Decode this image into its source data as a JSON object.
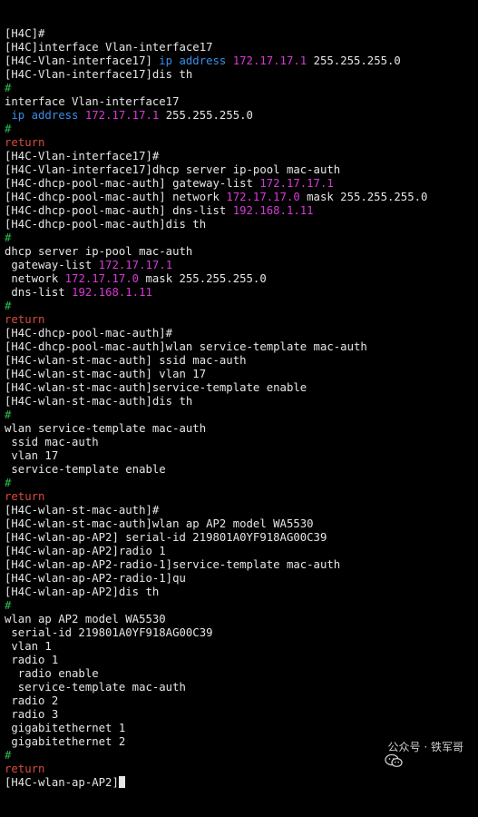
{
  "colors": {
    "text": "#e6e6e6",
    "keyword": "#3a8ee6",
    "ip": "#d63ad6",
    "comment": "#2fb84e",
    "return": "#d94b3c",
    "background": "#000000"
  },
  "lines": [
    [
      {
        "t": "[H4C]#",
        "c": "text"
      }
    ],
    [
      {
        "t": "[H4C]interface Vlan-interface17",
        "c": "text"
      }
    ],
    [
      {
        "t": "[H4C-Vlan-interface17] ",
        "c": "text"
      },
      {
        "t": "ip address",
        "c": "keyword"
      },
      {
        "t": " ",
        "c": "text"
      },
      {
        "t": "172.17.17.1",
        "c": "ip"
      },
      {
        "t": " 255.255.255.0",
        "c": "text"
      }
    ],
    [
      {
        "t": "[H4C-Vlan-interface17]dis th",
        "c": "text"
      }
    ],
    [
      {
        "t": "#",
        "c": "comment"
      }
    ],
    [
      {
        "t": "interface Vlan-interface17",
        "c": "text"
      }
    ],
    [
      {
        "t": " ",
        "c": "text"
      },
      {
        "t": "ip address",
        "c": "keyword"
      },
      {
        "t": " ",
        "c": "text"
      },
      {
        "t": "172.17.17.1",
        "c": "ip"
      },
      {
        "t": " 255.255.255.0",
        "c": "text"
      }
    ],
    [
      {
        "t": "#",
        "c": "comment"
      }
    ],
    [
      {
        "t": "return",
        "c": "return"
      }
    ],
    [
      {
        "t": "[H4C-Vlan-interface17]#",
        "c": "text"
      }
    ],
    [
      {
        "t": "[H4C-Vlan-interface17]dhcp server ip-pool mac-auth",
        "c": "text"
      }
    ],
    [
      {
        "t": "[H4C-dhcp-pool-mac-auth] gateway-list ",
        "c": "text"
      },
      {
        "t": "172.17.17.1",
        "c": "ip"
      }
    ],
    [
      {
        "t": "[H4C-dhcp-pool-mac-auth] network ",
        "c": "text"
      },
      {
        "t": "172.17.17.0",
        "c": "ip"
      },
      {
        "t": " mask 255.255.255.0",
        "c": "text"
      }
    ],
    [
      {
        "t": "[H4C-dhcp-pool-mac-auth] dns-list ",
        "c": "text"
      },
      {
        "t": "192.168.1.11",
        "c": "ip"
      }
    ],
    [
      {
        "t": "[H4C-dhcp-pool-mac-auth]dis th",
        "c": "text"
      }
    ],
    [
      {
        "t": "#",
        "c": "comment"
      }
    ],
    [
      {
        "t": "dhcp server ip-pool mac-auth",
        "c": "text"
      }
    ],
    [
      {
        "t": " gateway-list ",
        "c": "text"
      },
      {
        "t": "172.17.17.1",
        "c": "ip"
      }
    ],
    [
      {
        "t": " network ",
        "c": "text"
      },
      {
        "t": "172.17.17.0",
        "c": "ip"
      },
      {
        "t": " mask 255.255.255.0",
        "c": "text"
      }
    ],
    [
      {
        "t": " dns-list ",
        "c": "text"
      },
      {
        "t": "192.168.1.11",
        "c": "ip"
      }
    ],
    [
      {
        "t": "#",
        "c": "comment"
      }
    ],
    [
      {
        "t": "return",
        "c": "return"
      }
    ],
    [
      {
        "t": "[H4C-dhcp-pool-mac-auth]#",
        "c": "text"
      }
    ],
    [
      {
        "t": "[H4C-dhcp-pool-mac-auth]wlan service-template mac-auth",
        "c": "text"
      }
    ],
    [
      {
        "t": "[H4C-wlan-st-mac-auth] ssid mac-auth",
        "c": "text"
      }
    ],
    [
      {
        "t": "[H4C-wlan-st-mac-auth] vlan 17",
        "c": "text"
      }
    ],
    [
      {
        "t": "[H4C-wlan-st-mac-auth]service-template enable",
        "c": "text"
      }
    ],
    [
      {
        "t": "[H4C-wlan-st-mac-auth]dis th",
        "c": "text"
      }
    ],
    [
      {
        "t": "#",
        "c": "comment"
      }
    ],
    [
      {
        "t": "wlan service-template mac-auth",
        "c": "text"
      }
    ],
    [
      {
        "t": " ssid mac-auth",
        "c": "text"
      }
    ],
    [
      {
        "t": " vlan 17",
        "c": "text"
      }
    ],
    [
      {
        "t": " service-template enable",
        "c": "text"
      }
    ],
    [
      {
        "t": "#",
        "c": "comment"
      }
    ],
    [
      {
        "t": "return",
        "c": "return"
      }
    ],
    [
      {
        "t": "[H4C-wlan-st-mac-auth]#",
        "c": "text"
      }
    ],
    [
      {
        "t": "[H4C-wlan-st-mac-auth]wlan ap AP2 model WA5530",
        "c": "text"
      }
    ],
    [
      {
        "t": "[H4C-wlan-ap-AP2] serial-id 219801A0YF918AG00C39",
        "c": "text"
      }
    ],
    [
      {
        "t": "[H4C-wlan-ap-AP2]radio 1",
        "c": "text"
      }
    ],
    [
      {
        "t": "[H4C-wlan-ap-AP2-radio-1]service-template mac-auth",
        "c": "text"
      }
    ],
    [
      {
        "t": "[H4C-wlan-ap-AP2-radio-1]qu",
        "c": "text"
      }
    ],
    [
      {
        "t": "[H4C-wlan-ap-AP2]dis th",
        "c": "text"
      }
    ],
    [
      {
        "t": "#",
        "c": "comment"
      }
    ],
    [
      {
        "t": "wlan ap AP2 model WA5530",
        "c": "text"
      }
    ],
    [
      {
        "t": " serial-id 219801A0YF918AG00C39",
        "c": "text"
      }
    ],
    [
      {
        "t": " vlan 1",
        "c": "text"
      }
    ],
    [
      {
        "t": " radio 1",
        "c": "text"
      }
    ],
    [
      {
        "t": "  radio enable",
        "c": "text"
      }
    ],
    [
      {
        "t": "  service-template mac-auth",
        "c": "text"
      }
    ],
    [
      {
        "t": " radio 2",
        "c": "text"
      }
    ],
    [
      {
        "t": " radio 3",
        "c": "text"
      }
    ],
    [
      {
        "t": " gigabitethernet 1",
        "c": "text"
      }
    ],
    [
      {
        "t": " gigabitethernet 2",
        "c": "text"
      }
    ],
    [
      {
        "t": "#",
        "c": "comment"
      }
    ],
    [
      {
        "t": "return",
        "c": "return"
      }
    ],
    [
      {
        "t": "[H4C-wlan-ap-AP2]",
        "c": "text"
      }
    ]
  ],
  "watermark": {
    "icon": "wechat-icon",
    "text": "公众号 · 铁军哥"
  }
}
